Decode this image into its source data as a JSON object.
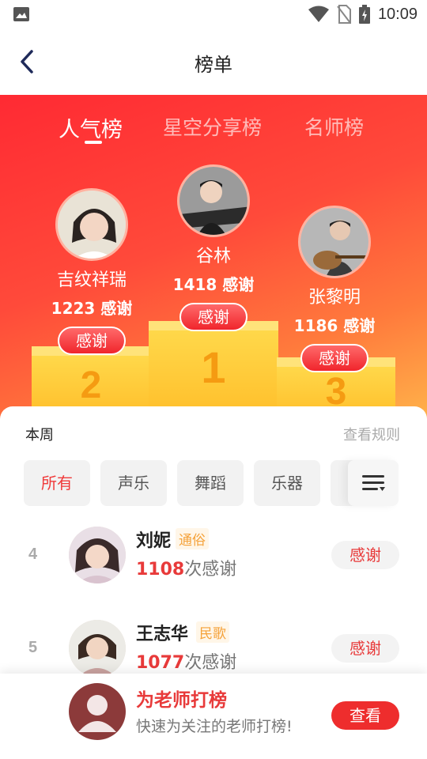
{
  "status": {
    "time": "10:09",
    "icons": [
      "image-icon",
      "wifi-icon",
      "no-sim-icon",
      "battery-charging-icon"
    ]
  },
  "header": {
    "title": "榜单",
    "back_icon": "chevron-left-icon"
  },
  "tabs": [
    {
      "label": "人气榜",
      "active": true
    },
    {
      "label": "星空分享榜",
      "active": false
    },
    {
      "label": "名师榜",
      "active": false
    }
  ],
  "podium": {
    "first": {
      "rank": "1",
      "name": "谷林",
      "count": "1418 感谢",
      "button": "感谢"
    },
    "second": {
      "rank": "2",
      "name": "吉纹祥瑞",
      "count": "1223 感谢",
      "button": "感谢"
    },
    "third": {
      "rank": "3",
      "name": "张黎明",
      "count": "1186 感谢",
      "button": "感谢"
    }
  },
  "panel": {
    "period": "本周",
    "rules_link": "查看规则",
    "filters": [
      "所有",
      "声乐",
      "舞蹈",
      "乐器",
      "纟"
    ],
    "active_filter": "所有",
    "filter_icon": "sort-filter-icon"
  },
  "list": [
    {
      "rank": "4",
      "name": "刘妮",
      "tag": "通俗",
      "count_num": "1108",
      "count_suffix": "次感谢",
      "button": "感谢"
    },
    {
      "rank": "5",
      "name": "王志华",
      "tag": "民歌",
      "count_num": "1077",
      "count_suffix": "次感谢",
      "button": "感谢"
    }
  ],
  "promo": {
    "title": "为老师打榜",
    "subtitle": "快速为关注的老师打榜!",
    "button": "查看",
    "avatar_icon": "user-placeholder-icon"
  },
  "colors": {
    "accent": "#e83a3a",
    "hero_start": "#ff2a33",
    "hero_end": "#ffb24a",
    "tag": "#f5a23a"
  }
}
